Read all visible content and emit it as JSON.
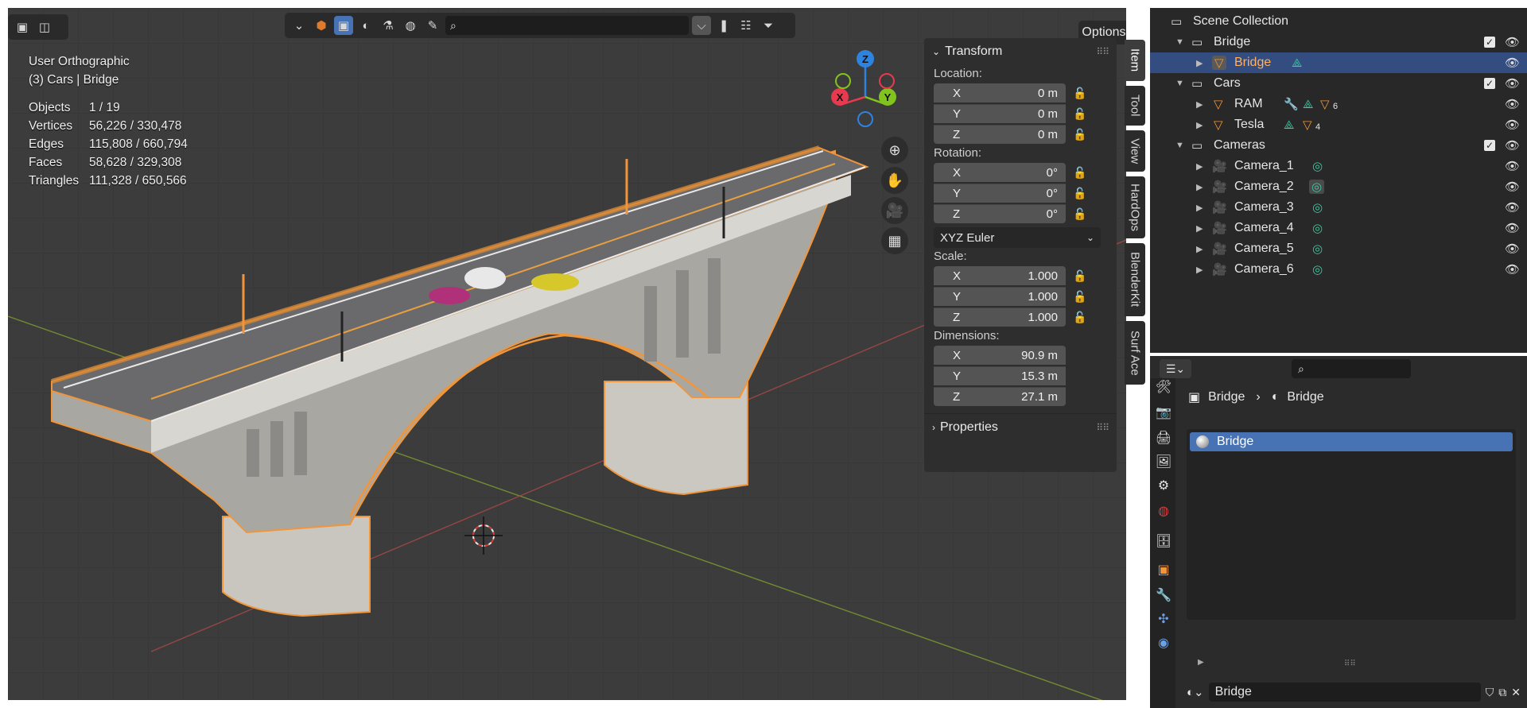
{
  "viewport": {
    "view_name": "User Orthographic",
    "context": "(3) Cars | Bridge",
    "stats": [
      {
        "label": "Objects",
        "value": "1 / 19"
      },
      {
        "label": "Vertices",
        "value": "56,226 / 330,478"
      },
      {
        "label": "Edges",
        "value": "115,808 / 660,794"
      },
      {
        "label": "Faces",
        "value": "58,628 / 329,308"
      },
      {
        "label": "Triangles",
        "value": "111,328 / 650,566"
      }
    ],
    "options_label": "Options",
    "gizmo": {
      "z": "Z",
      "y": "Y",
      "x": "X"
    }
  },
  "npanel": {
    "transform_title": "Transform",
    "location_label": "Location:",
    "location": [
      {
        "axis": "X",
        "value": "0 m"
      },
      {
        "axis": "Y",
        "value": "0 m"
      },
      {
        "axis": "Z",
        "value": "0 m"
      }
    ],
    "rotation_label": "Rotation:",
    "rotation": [
      {
        "axis": "X",
        "value": "0°"
      },
      {
        "axis": "Y",
        "value": "0°"
      },
      {
        "axis": "Z",
        "value": "0°"
      }
    ],
    "rotation_mode": "XYZ Euler",
    "scale_label": "Scale:",
    "scale": [
      {
        "axis": "X",
        "value": "1.000"
      },
      {
        "axis": "Y",
        "value": "1.000"
      },
      {
        "axis": "Z",
        "value": "1.000"
      }
    ],
    "dimensions_label": "Dimensions:",
    "dimensions": [
      {
        "axis": "X",
        "value": "90.9 m"
      },
      {
        "axis": "Y",
        "value": "15.3 m"
      },
      {
        "axis": "Z",
        "value": "27.1 m"
      }
    ],
    "properties_title": "Properties",
    "tabs": [
      "Item",
      "Tool",
      "View",
      "HardOps",
      "BlenderKit",
      "Surf Ace"
    ]
  },
  "outliner": {
    "scene_collection": "Scene Collection",
    "rows": [
      {
        "name": "Bridge",
        "type": "collection"
      },
      {
        "name": "Bridge",
        "type": "mesh"
      },
      {
        "name": "Cars",
        "type": "collection"
      },
      {
        "name": "RAM",
        "type": "mesh",
        "badge": "6"
      },
      {
        "name": "Tesla",
        "type": "mesh",
        "badge": "4"
      },
      {
        "name": "Cameras",
        "type": "collection"
      },
      {
        "name": "Camera_1",
        "type": "camera"
      },
      {
        "name": "Camera_2",
        "type": "camera"
      },
      {
        "name": "Camera_3",
        "type": "camera"
      },
      {
        "name": "Camera_4",
        "type": "camera"
      },
      {
        "name": "Camera_5",
        "type": "camera"
      },
      {
        "name": "Camera_6",
        "type": "camera"
      }
    ]
  },
  "properties": {
    "breadcrumb_object": "Bridge",
    "breadcrumb_material": "Bridge",
    "material_slot": "Bridge",
    "material_name": "Bridge"
  },
  "colors": {
    "accent": "#4772b3",
    "selection_outline": "#f0953a",
    "axis_x": "#e8394f",
    "axis_y": "#82c41e",
    "axis_z": "#2f83e0"
  }
}
